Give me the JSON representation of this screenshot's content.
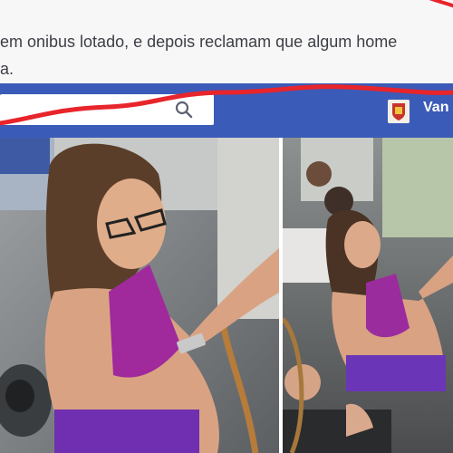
{
  "post": {
    "text_line1": "em onibus lotado, e depois reclamam que algum home",
    "text_line2": "a."
  },
  "navbar": {
    "bg_color": "#3b5bb8",
    "search": {
      "value": ""
    },
    "search_icon": "search-icon",
    "user_label": "Van",
    "avatar_icon": "profile-avatar"
  },
  "annotation": {
    "scribble_color": "#e8252b"
  },
  "photos": [
    {
      "name": "photo-left"
    },
    {
      "name": "photo-right"
    }
  ]
}
